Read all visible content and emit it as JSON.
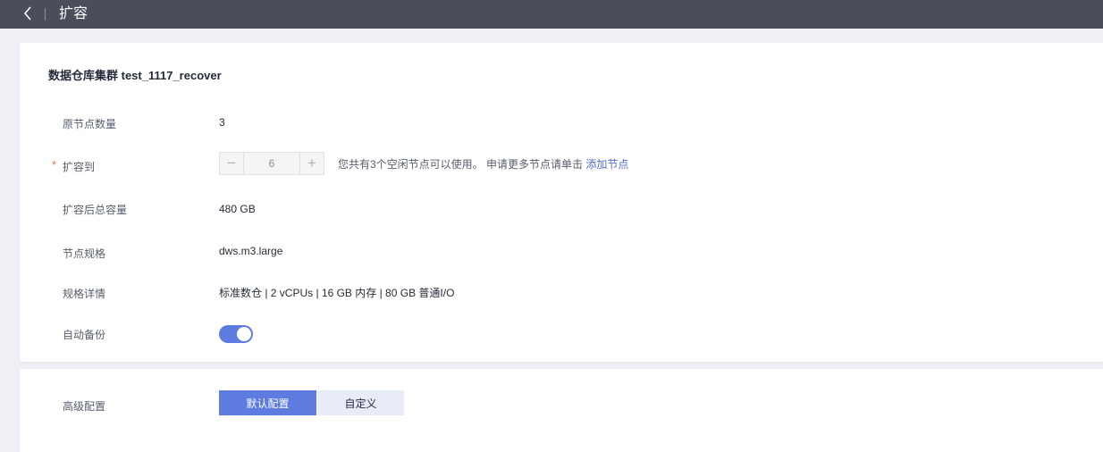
{
  "header": {
    "title": "扩容",
    "back_icon": "chevron-left-icon"
  },
  "cluster": {
    "title": "数据仓库集群 test_1117_recover"
  },
  "fields": {
    "original_nodes": {
      "label": "原节点数量",
      "value": "3"
    },
    "expand_to": {
      "label": "扩容到",
      "required_mark": "*",
      "value": "6",
      "minus": "−",
      "plus": "+",
      "hint": "您共有3个空闲节点可以使用。 申请更多节点请单击",
      "hint_link": "添加节点"
    },
    "total_capacity": {
      "label": "扩容后总容量",
      "value": "480 GB"
    },
    "node_flavor": {
      "label": "节点规格",
      "value": "dws.m3.large"
    },
    "flavor_details": {
      "label": "规格详情",
      "value": "标准数仓 | 2 vCPUs | 16 GB 内存 | 80 GB 普通I/O"
    },
    "auto_backup": {
      "label": "自动备份",
      "enabled": true
    }
  },
  "advanced": {
    "label": "高级配置",
    "options": [
      "默认配置",
      "自定义"
    ],
    "selected": "默认配置"
  },
  "colors": {
    "accent": "#5e7ce0",
    "topbar": "#4b4e5a",
    "link": "#526ecc",
    "required": "#f66f6a"
  }
}
